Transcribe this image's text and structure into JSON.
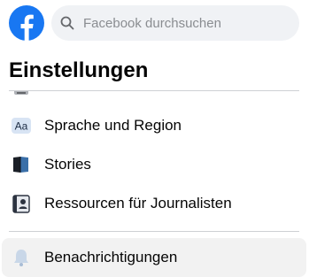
{
  "header": {
    "logo_icon": "facebook-logo-icon",
    "search": {
      "placeholder": "Facebook durchsuchen",
      "value": "",
      "icon": "search-icon"
    }
  },
  "page": {
    "title": "Einstellungen"
  },
  "colors": {
    "brand": "#1877f2",
    "search_bg": "#f0f2f5",
    "placeholder": "#8a8d91",
    "divider": "#ced0d4",
    "active_bg": "#f2f2f2"
  },
  "menu": {
    "items": [
      {
        "label": "Sprache und Region",
        "icon": "language-icon"
      },
      {
        "label": "Stories",
        "icon": "book-icon"
      },
      {
        "label": "Ressourcen für Journalisten",
        "icon": "journalist-badge-icon"
      }
    ],
    "notifications": {
      "label": "Benachrichtigungen",
      "icon": "bell-icon",
      "active": true
    }
  }
}
